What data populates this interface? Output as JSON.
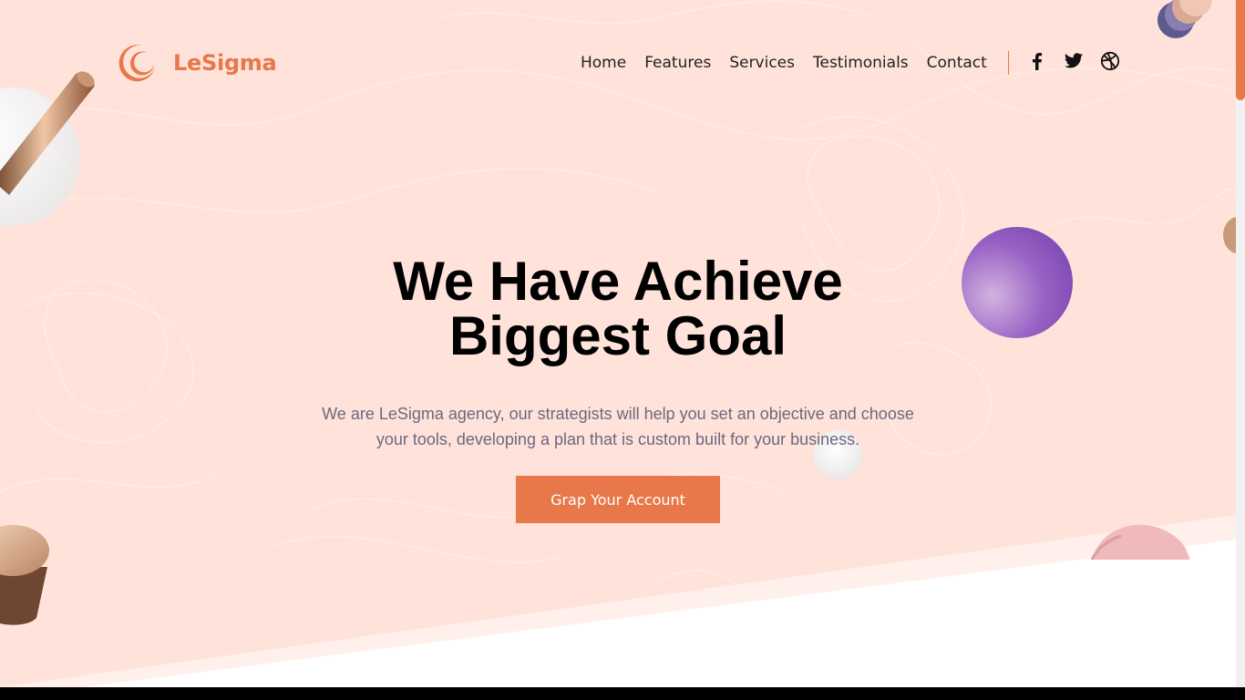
{
  "brand": {
    "name": "LeSigma",
    "accent_color": "#e8784a",
    "logo_icon": "crescent-logo-icon"
  },
  "nav": {
    "items": [
      {
        "label": "Home"
      },
      {
        "label": "Features"
      },
      {
        "label": "Services"
      },
      {
        "label": "Testimonials"
      },
      {
        "label": "Contact"
      }
    ]
  },
  "social": [
    {
      "icon": "facebook-icon"
    },
    {
      "icon": "twitter-icon"
    },
    {
      "icon": "dribbble-icon"
    }
  ],
  "hero": {
    "headline_line1": "We Have Achieve",
    "headline_line2": "Biggest Goal",
    "subtext": "We are LeSigma agency, our strategists will help you set an objective and choose your tools, developing a plan that is custom built for your business.",
    "cta_label": "Grap Your Account",
    "background_color": "#ffe3da"
  }
}
